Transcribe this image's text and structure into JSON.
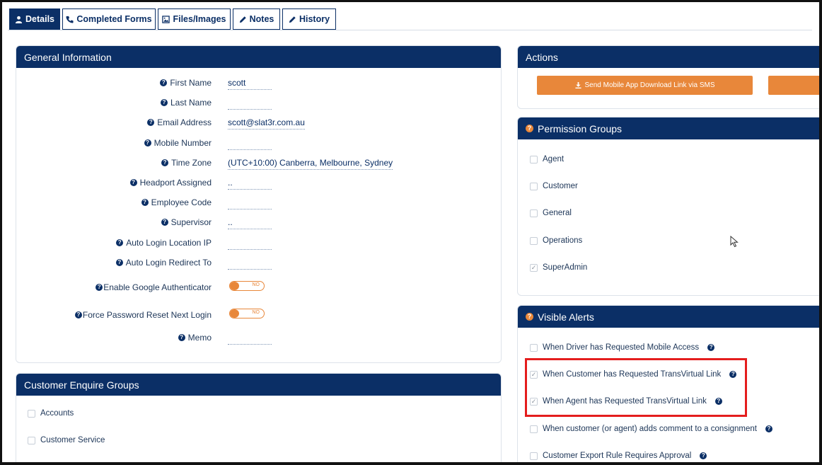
{
  "tabs": [
    {
      "label": "Details",
      "icon": "user-icon"
    },
    {
      "label": "Completed Forms",
      "icon": "phone-icon"
    },
    {
      "label": "Files/Images",
      "icon": "image-icon"
    },
    {
      "label": "Notes",
      "icon": "pencil-icon"
    },
    {
      "label": "History",
      "icon": "pencil-icon"
    }
  ],
  "general": {
    "title": "General Information",
    "fields": [
      {
        "label": "First Name",
        "value": "scott"
      },
      {
        "label": "Last Name",
        "value": ""
      },
      {
        "label": "Email Address",
        "value": "scott@slat3r.com.au"
      },
      {
        "label": "Mobile Number",
        "value": ""
      },
      {
        "label": "Time Zone",
        "value": "(UTC+10:00) Canberra, Melbourne, Sydney"
      },
      {
        "label": "Headport Assigned",
        "value": ".."
      },
      {
        "label": "Employee Code",
        "value": ""
      },
      {
        "label": "Supervisor",
        "value": ".."
      },
      {
        "label": "Auto Login Location IP",
        "value": ""
      },
      {
        "label": "Auto Login Redirect To",
        "value": ""
      },
      {
        "label": "Enable Google Authenticator",
        "value": "NO"
      },
      {
        "label": "Force Password Reset Next Login",
        "value": "NO"
      },
      {
        "label": "Memo",
        "value": ""
      }
    ]
  },
  "customer_groups": {
    "title": "Customer Enquire Groups",
    "items": [
      {
        "label": "Accounts",
        "checked": false
      },
      {
        "label": "Customer Service",
        "checked": false
      }
    ]
  },
  "actions": {
    "title": "Actions",
    "sms_button": "Send Mobile App Download Link via SMS"
  },
  "permissions": {
    "title": "Permission Groups",
    "items": [
      {
        "label": "Agent",
        "checked": false
      },
      {
        "label": "Customer",
        "checked": false
      },
      {
        "label": "General",
        "checked": false
      },
      {
        "label": "Operations",
        "checked": false
      },
      {
        "label": "SuperAdmin",
        "checked": true
      }
    ]
  },
  "alerts": {
    "title": "Visible Alerts",
    "items": [
      {
        "label": "When Driver has Requested Mobile Access",
        "checked": false
      },
      {
        "label": "When Customer has Requested TransVirtual Link",
        "checked": true
      },
      {
        "label": "When Agent has Requested TransVirtual Link",
        "checked": true
      },
      {
        "label": "When customer (or agent) adds comment to a consignment",
        "checked": false
      },
      {
        "label": "Customer Export Rule Requires Approval",
        "checked": false
      }
    ]
  },
  "colors": {
    "navy": "#0b2f66",
    "orange": "#e8873a",
    "highlight": "#e41d1d"
  },
  "help_glyph": "?",
  "check_glyph": "✓"
}
